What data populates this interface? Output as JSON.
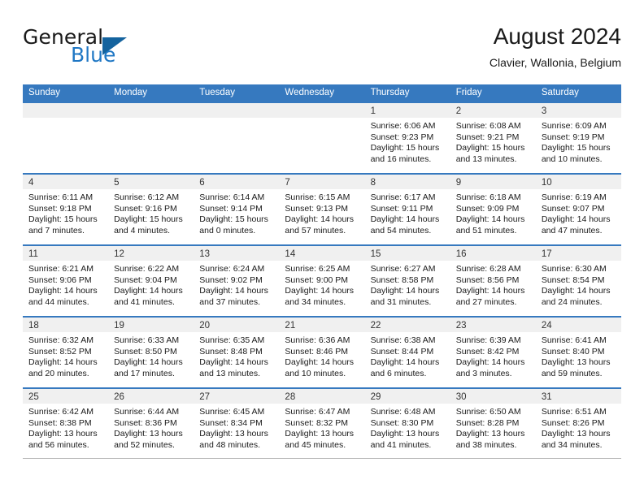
{
  "brand": {
    "name_part1": "General",
    "name_part2": "Blue",
    "triangle_color": "#14639e",
    "blue_color": "#1f77c4"
  },
  "header": {
    "title": "August 2024",
    "location": "Clavier, Wallonia, Belgium"
  },
  "theme": {
    "header_blue": "#3679bf",
    "daynum_band": "#f0f0f0",
    "text": "#1a1a1a"
  },
  "weekdays": [
    "Sunday",
    "Monday",
    "Tuesday",
    "Wednesday",
    "Thursday",
    "Friday",
    "Saturday"
  ],
  "weeks": [
    [
      {
        "day": "",
        "empty": true
      },
      {
        "day": "",
        "empty": true
      },
      {
        "day": "",
        "empty": true
      },
      {
        "day": "",
        "empty": true
      },
      {
        "day": "1",
        "sunrise": "Sunrise: 6:06 AM",
        "sunset": "Sunset: 9:23 PM",
        "daylight1": "Daylight: 15 hours",
        "daylight2": "and 16 minutes."
      },
      {
        "day": "2",
        "sunrise": "Sunrise: 6:08 AM",
        "sunset": "Sunset: 9:21 PM",
        "daylight1": "Daylight: 15 hours",
        "daylight2": "and 13 minutes."
      },
      {
        "day": "3",
        "sunrise": "Sunrise: 6:09 AM",
        "sunset": "Sunset: 9:19 PM",
        "daylight1": "Daylight: 15 hours",
        "daylight2": "and 10 minutes."
      }
    ],
    [
      {
        "day": "4",
        "sunrise": "Sunrise: 6:11 AM",
        "sunset": "Sunset: 9:18 PM",
        "daylight1": "Daylight: 15 hours",
        "daylight2": "and 7 minutes."
      },
      {
        "day": "5",
        "sunrise": "Sunrise: 6:12 AM",
        "sunset": "Sunset: 9:16 PM",
        "daylight1": "Daylight: 15 hours",
        "daylight2": "and 4 minutes."
      },
      {
        "day": "6",
        "sunrise": "Sunrise: 6:14 AM",
        "sunset": "Sunset: 9:14 PM",
        "daylight1": "Daylight: 15 hours",
        "daylight2": "and 0 minutes."
      },
      {
        "day": "7",
        "sunrise": "Sunrise: 6:15 AM",
        "sunset": "Sunset: 9:13 PM",
        "daylight1": "Daylight: 14 hours",
        "daylight2": "and 57 minutes."
      },
      {
        "day": "8",
        "sunrise": "Sunrise: 6:17 AM",
        "sunset": "Sunset: 9:11 PM",
        "daylight1": "Daylight: 14 hours",
        "daylight2": "and 54 minutes."
      },
      {
        "day": "9",
        "sunrise": "Sunrise: 6:18 AM",
        "sunset": "Sunset: 9:09 PM",
        "daylight1": "Daylight: 14 hours",
        "daylight2": "and 51 minutes."
      },
      {
        "day": "10",
        "sunrise": "Sunrise: 6:19 AM",
        "sunset": "Sunset: 9:07 PM",
        "daylight1": "Daylight: 14 hours",
        "daylight2": "and 47 minutes."
      }
    ],
    [
      {
        "day": "11",
        "sunrise": "Sunrise: 6:21 AM",
        "sunset": "Sunset: 9:06 PM",
        "daylight1": "Daylight: 14 hours",
        "daylight2": "and 44 minutes."
      },
      {
        "day": "12",
        "sunrise": "Sunrise: 6:22 AM",
        "sunset": "Sunset: 9:04 PM",
        "daylight1": "Daylight: 14 hours",
        "daylight2": "and 41 minutes."
      },
      {
        "day": "13",
        "sunrise": "Sunrise: 6:24 AM",
        "sunset": "Sunset: 9:02 PM",
        "daylight1": "Daylight: 14 hours",
        "daylight2": "and 37 minutes."
      },
      {
        "day": "14",
        "sunrise": "Sunrise: 6:25 AM",
        "sunset": "Sunset: 9:00 PM",
        "daylight1": "Daylight: 14 hours",
        "daylight2": "and 34 minutes."
      },
      {
        "day": "15",
        "sunrise": "Sunrise: 6:27 AM",
        "sunset": "Sunset: 8:58 PM",
        "daylight1": "Daylight: 14 hours",
        "daylight2": "and 31 minutes."
      },
      {
        "day": "16",
        "sunrise": "Sunrise: 6:28 AM",
        "sunset": "Sunset: 8:56 PM",
        "daylight1": "Daylight: 14 hours",
        "daylight2": "and 27 minutes."
      },
      {
        "day": "17",
        "sunrise": "Sunrise: 6:30 AM",
        "sunset": "Sunset: 8:54 PM",
        "daylight1": "Daylight: 14 hours",
        "daylight2": "and 24 minutes."
      }
    ],
    [
      {
        "day": "18",
        "sunrise": "Sunrise: 6:32 AM",
        "sunset": "Sunset: 8:52 PM",
        "daylight1": "Daylight: 14 hours",
        "daylight2": "and 20 minutes."
      },
      {
        "day": "19",
        "sunrise": "Sunrise: 6:33 AM",
        "sunset": "Sunset: 8:50 PM",
        "daylight1": "Daylight: 14 hours",
        "daylight2": "and 17 minutes."
      },
      {
        "day": "20",
        "sunrise": "Sunrise: 6:35 AM",
        "sunset": "Sunset: 8:48 PM",
        "daylight1": "Daylight: 14 hours",
        "daylight2": "and 13 minutes."
      },
      {
        "day": "21",
        "sunrise": "Sunrise: 6:36 AM",
        "sunset": "Sunset: 8:46 PM",
        "daylight1": "Daylight: 14 hours",
        "daylight2": "and 10 minutes."
      },
      {
        "day": "22",
        "sunrise": "Sunrise: 6:38 AM",
        "sunset": "Sunset: 8:44 PM",
        "daylight1": "Daylight: 14 hours",
        "daylight2": "and 6 minutes."
      },
      {
        "day": "23",
        "sunrise": "Sunrise: 6:39 AM",
        "sunset": "Sunset: 8:42 PM",
        "daylight1": "Daylight: 14 hours",
        "daylight2": "and 3 minutes."
      },
      {
        "day": "24",
        "sunrise": "Sunrise: 6:41 AM",
        "sunset": "Sunset: 8:40 PM",
        "daylight1": "Daylight: 13 hours",
        "daylight2": "and 59 minutes."
      }
    ],
    [
      {
        "day": "25",
        "sunrise": "Sunrise: 6:42 AM",
        "sunset": "Sunset: 8:38 PM",
        "daylight1": "Daylight: 13 hours",
        "daylight2": "and 56 minutes."
      },
      {
        "day": "26",
        "sunrise": "Sunrise: 6:44 AM",
        "sunset": "Sunset: 8:36 PM",
        "daylight1": "Daylight: 13 hours",
        "daylight2": "and 52 minutes."
      },
      {
        "day": "27",
        "sunrise": "Sunrise: 6:45 AM",
        "sunset": "Sunset: 8:34 PM",
        "daylight1": "Daylight: 13 hours",
        "daylight2": "and 48 minutes."
      },
      {
        "day": "28",
        "sunrise": "Sunrise: 6:47 AM",
        "sunset": "Sunset: 8:32 PM",
        "daylight1": "Daylight: 13 hours",
        "daylight2": "and 45 minutes."
      },
      {
        "day": "29",
        "sunrise": "Sunrise: 6:48 AM",
        "sunset": "Sunset: 8:30 PM",
        "daylight1": "Daylight: 13 hours",
        "daylight2": "and 41 minutes."
      },
      {
        "day": "30",
        "sunrise": "Sunrise: 6:50 AM",
        "sunset": "Sunset: 8:28 PM",
        "daylight1": "Daylight: 13 hours",
        "daylight2": "and 38 minutes."
      },
      {
        "day": "31",
        "sunrise": "Sunrise: 6:51 AM",
        "sunset": "Sunset: 8:26 PM",
        "daylight1": "Daylight: 13 hours",
        "daylight2": "and 34 minutes."
      }
    ]
  ]
}
